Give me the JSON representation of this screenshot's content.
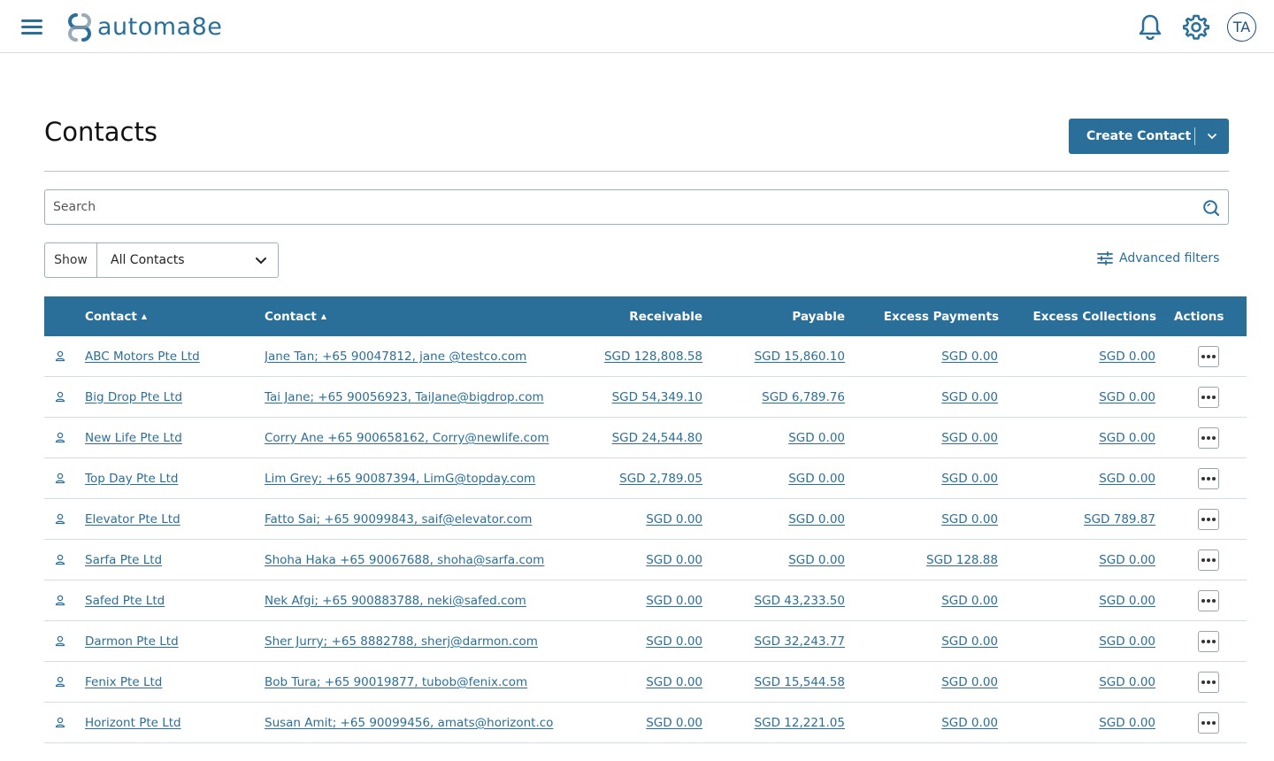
{
  "header": {
    "logo_text": "automa8e",
    "avatar_initials": "TA",
    "icons": [
      "menu-icon",
      "bell-icon",
      "gear-icon"
    ],
    "brand_color": "#2a6f99"
  },
  "page": {
    "title": "Contacts",
    "create_button_label": "Create Contact"
  },
  "search": {
    "placeholder": "Search"
  },
  "filters": {
    "show_label": "Show",
    "show_value": "All Contacts",
    "advanced_label": "Advanced filters"
  },
  "table": {
    "headers": {
      "contact_name": "Contact",
      "contact_details": "Contact",
      "receivable": "Receivable",
      "payable": "Payable",
      "excess_payments": "Excess Payments",
      "excess_collections": "Excess Collections",
      "actions": "Actions"
    },
    "rows": [
      {
        "name": "ABC Motors Pte Ltd",
        "contact": "Jane Tan; +65 90047812, jane @testco.com",
        "receivable": "SGD 128,808.58",
        "payable": "SGD 15,860.10",
        "excess_payments": "SGD 0.00",
        "excess_collections": "SGD 0.00"
      },
      {
        "name": "Big Drop Pte Ltd",
        "contact": "Tai Jane; +65 90056923, TaiJane@bigdrop.com",
        "receivable": "SGD 54,349.10",
        "payable": "SGD 6,789.76",
        "excess_payments": "SGD 0.00",
        "excess_collections": "SGD 0.00"
      },
      {
        "name": "New Life Pte Ltd",
        "contact": "Corry Ane +65 900658162, Corry@newlife.com",
        "receivable": "SGD 24,544.80",
        "payable": "SGD 0.00",
        "excess_payments": "SGD 0.00",
        "excess_collections": "SGD 0.00"
      },
      {
        "name": "Top Day Pte Ltd",
        "contact": "Lim Grey; +65 90087394, LimG@topday.com",
        "receivable": "SGD 2,789.05",
        "payable": "SGD 0.00",
        "excess_payments": "SGD 0.00",
        "excess_collections": "SGD 0.00"
      },
      {
        "name": "Elevator Pte Ltd",
        "contact": "Fatto Sai; +65 90099843, saif@elevator.com",
        "receivable": "SGD 0.00",
        "payable": "SGD 0.00",
        "excess_payments": "SGD 0.00",
        "excess_collections": "SGD 789.87"
      },
      {
        "name": "Sarfa Pte Ltd",
        "contact": "Shoha Haka +65 90067688, shoha@sarfa.com",
        "receivable": "SGD 0.00",
        "payable": "SGD 0.00",
        "excess_payments": "SGD 128.88",
        "excess_collections": "SGD 0.00"
      },
      {
        "name": "Safed Pte Ltd",
        "contact": "Nek Afgi; +65 900883788, neki@safed.com",
        "receivable": "SGD 0.00",
        "payable": "SGD 43,233.50",
        "excess_payments": "SGD 0.00",
        "excess_collections": "SGD 0.00"
      },
      {
        "name": "Darmon Pte Ltd",
        "contact": "Sher Jurry; +65 8882788, sherj@darmon.com",
        "receivable": "SGD 0.00",
        "payable": "SGD 32,243.77",
        "excess_payments": "SGD 0.00",
        "excess_collections": "SGD 0.00"
      },
      {
        "name": "Fenix  Pte Ltd",
        "contact": "Bob Tura; +65 90019877, tubob@fenix.com",
        "receivable": "SGD 0.00",
        "payable": "SGD 15,544.58",
        "excess_payments": "SGD 0.00",
        "excess_collections": "SGD 0.00"
      },
      {
        "name": "Horizont Pte Ltd",
        "contact": "Susan Amit; +65 90099456, amats@horizont.co",
        "receivable": "SGD 0.00",
        "payable": "SGD 12,221.05",
        "excess_payments": "SGD 0.00",
        "excess_collections": "SGD 0.00"
      }
    ]
  }
}
